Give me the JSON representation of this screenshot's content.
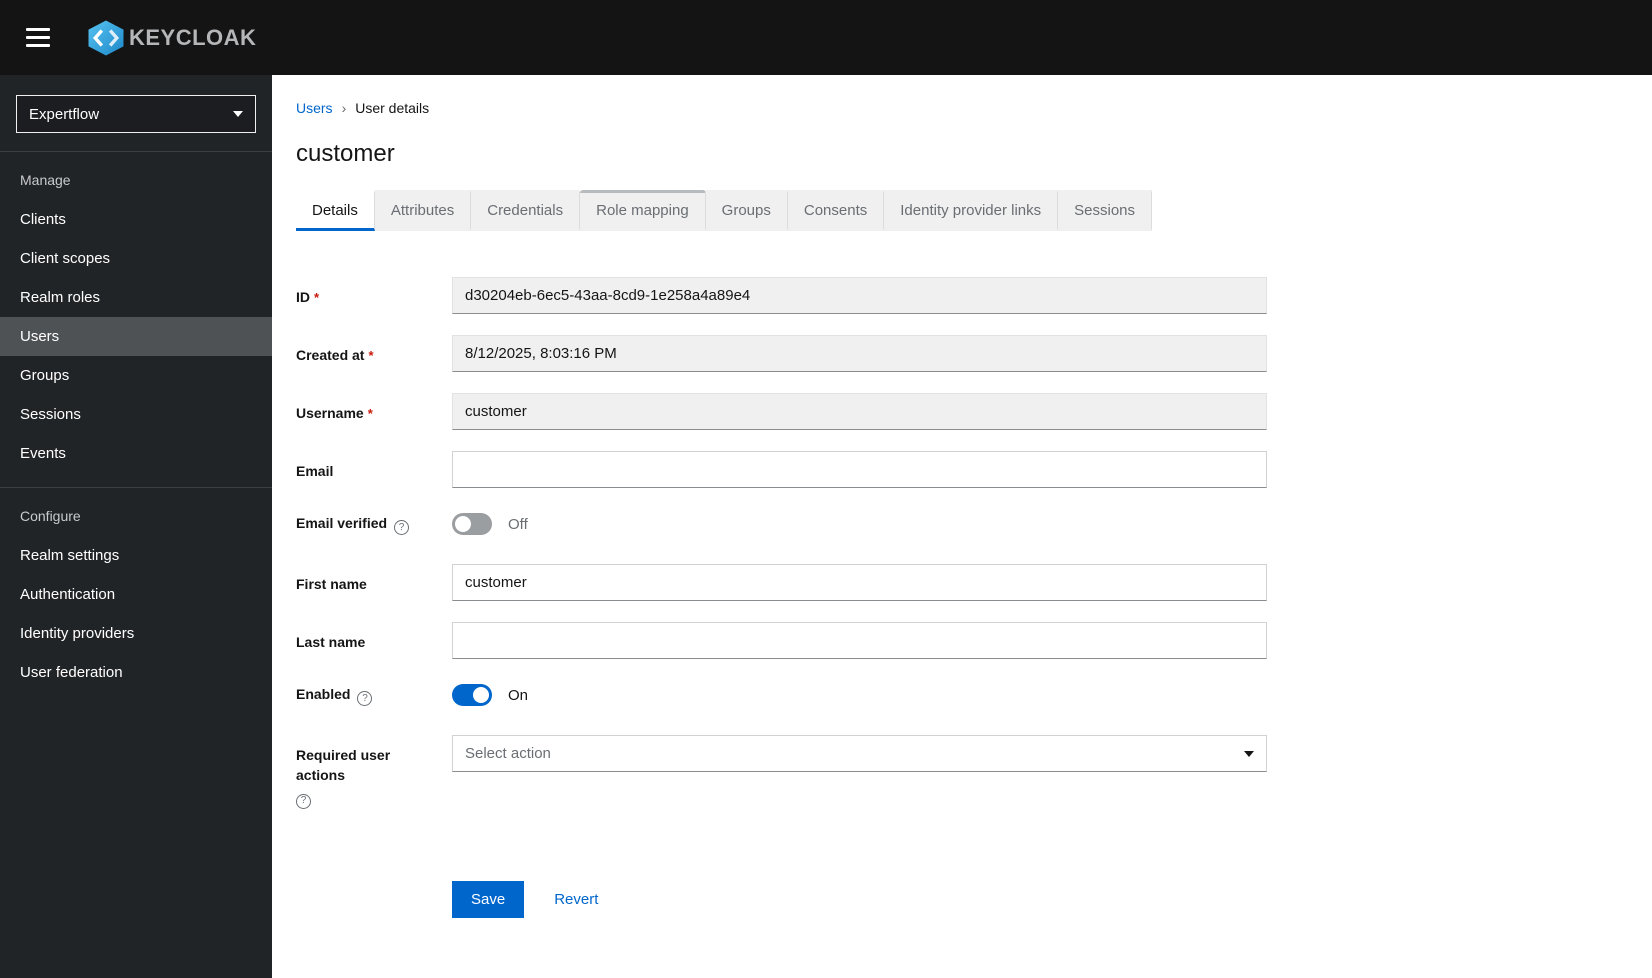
{
  "topbar": {
    "brand": "KEYCLOAK"
  },
  "icons": {
    "help": "?"
  },
  "sidebar": {
    "realm": "Expertflow",
    "manage_label": "Manage",
    "manage_items": [
      {
        "label": "Clients"
      },
      {
        "label": "Client scopes"
      },
      {
        "label": "Realm roles"
      },
      {
        "label": "Users"
      },
      {
        "label": "Groups"
      },
      {
        "label": "Sessions"
      },
      {
        "label": "Events"
      }
    ],
    "configure_label": "Configure",
    "configure_items": [
      {
        "label": "Realm settings"
      },
      {
        "label": "Authentication"
      },
      {
        "label": "Identity providers"
      },
      {
        "label": "User federation"
      }
    ]
  },
  "breadcrumb": {
    "users": "Users",
    "separator": "›",
    "current": "User details"
  },
  "page_title": "customer",
  "tabs": [
    {
      "label": "Details"
    },
    {
      "label": "Attributes"
    },
    {
      "label": "Credentials"
    },
    {
      "label": "Role mapping"
    },
    {
      "label": "Groups"
    },
    {
      "label": "Consents"
    },
    {
      "label": "Identity provider links"
    },
    {
      "label": "Sessions"
    }
  ],
  "form": {
    "id": {
      "label": "ID",
      "required": "*",
      "value": "d30204eb-6ec5-43aa-8cd9-1e258a4a89e4"
    },
    "created_at": {
      "label": "Created at",
      "required": "*",
      "value": "8/12/2025, 8:03:16 PM"
    },
    "username": {
      "label": "Username",
      "required": "*",
      "value": "customer"
    },
    "email": {
      "label": "Email",
      "value": ""
    },
    "email_verified": {
      "label": "Email verified",
      "state": "Off"
    },
    "first_name": {
      "label": "First name",
      "value": "customer"
    },
    "last_name": {
      "label": "Last name",
      "value": ""
    },
    "enabled": {
      "label": "Enabled",
      "state": "On"
    },
    "required_actions": {
      "label": "Required user actions",
      "placeholder": "Select action"
    }
  },
  "actions": {
    "save": "Save",
    "revert": "Revert"
  },
  "colors": {
    "accent": "#0066cc",
    "danger": "#c9190b",
    "topbar": "#141414",
    "sidebar": "#212427"
  }
}
